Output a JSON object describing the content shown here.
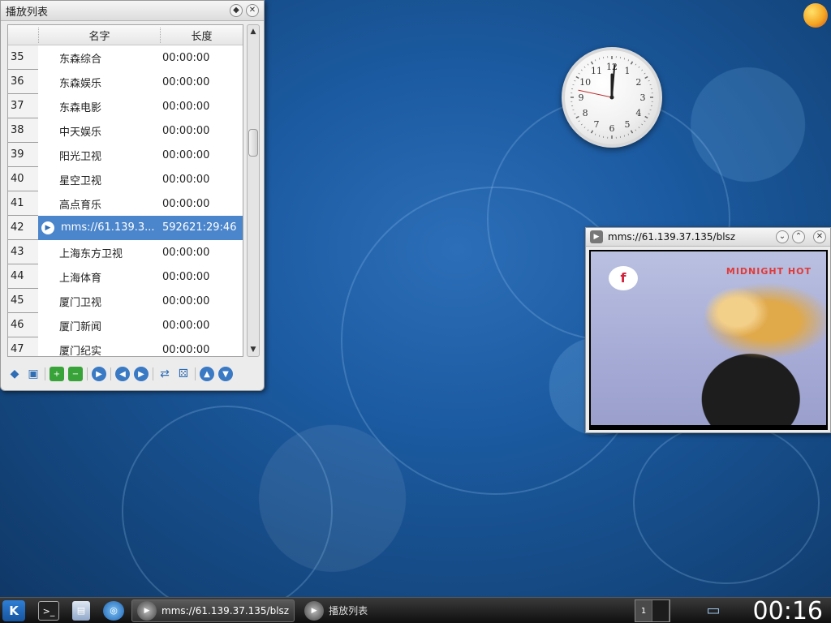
{
  "playlist": {
    "title": "播放列表",
    "columns": {
      "name": "名字",
      "length": "长度"
    },
    "rows": [
      {
        "num": "35",
        "name": "东森综合",
        "length": "00:00:00"
      },
      {
        "num": "36",
        "name": "东森娱乐",
        "length": "00:00:00"
      },
      {
        "num": "37",
        "name": "东森电影",
        "length": "00:00:00"
      },
      {
        "num": "38",
        "name": "中天娱乐",
        "length": "00:00:00"
      },
      {
        "num": "39",
        "name": "阳光卫视",
        "length": "00:00:00"
      },
      {
        "num": "40",
        "name": "星空卫视",
        "length": "00:00:00"
      },
      {
        "num": "41",
        "name": "高点育乐",
        "length": "00:00:00"
      },
      {
        "num": "42",
        "name": "mms://61.139.3...",
        "length": "592621:29:46"
      },
      {
        "num": "43",
        "name": "上海东方卫视",
        "length": "00:00:00"
      },
      {
        "num": "44",
        "name": "上海体育",
        "length": "00:00:00"
      },
      {
        "num": "45",
        "name": "厦门卫视",
        "length": "00:00:00"
      },
      {
        "num": "46",
        "name": "厦门新闻",
        "length": "00:00:00"
      },
      {
        "num": "47",
        "name": "厦门纪实",
        "length": "00:00:00"
      }
    ],
    "selected_index": 7,
    "toolbar": [
      "clear-icon",
      "save-icon",
      "add-icon",
      "remove-icon",
      "play-icon",
      "previous-icon",
      "next-icon",
      "repeat-icon",
      "shuffle-icon",
      "move-up-icon",
      "move-down-icon"
    ]
  },
  "clock": {
    "numbers": [
      "12",
      "1",
      "2",
      "3",
      "4",
      "5",
      "6",
      "7",
      "8",
      "9",
      "10",
      "11"
    ],
    "hour": 12,
    "minute": 0,
    "second": 47
  },
  "video": {
    "title": "mms://61.139.37.135/blsz",
    "logo_text": "f",
    "caption": "MIDNIGHT HOT"
  },
  "taskbar": {
    "kmenu_label": "K",
    "tasks": [
      {
        "label": "mms://61.139.37.135/blsz",
        "active": true
      },
      {
        "label": "播放列表",
        "active": false
      }
    ],
    "pager": [
      "1",
      ""
    ],
    "time": "00:16"
  },
  "colors": {
    "selection": "#4b86cc",
    "desktop": "#1b5aa0",
    "taskbar": "#1a1a1a"
  }
}
